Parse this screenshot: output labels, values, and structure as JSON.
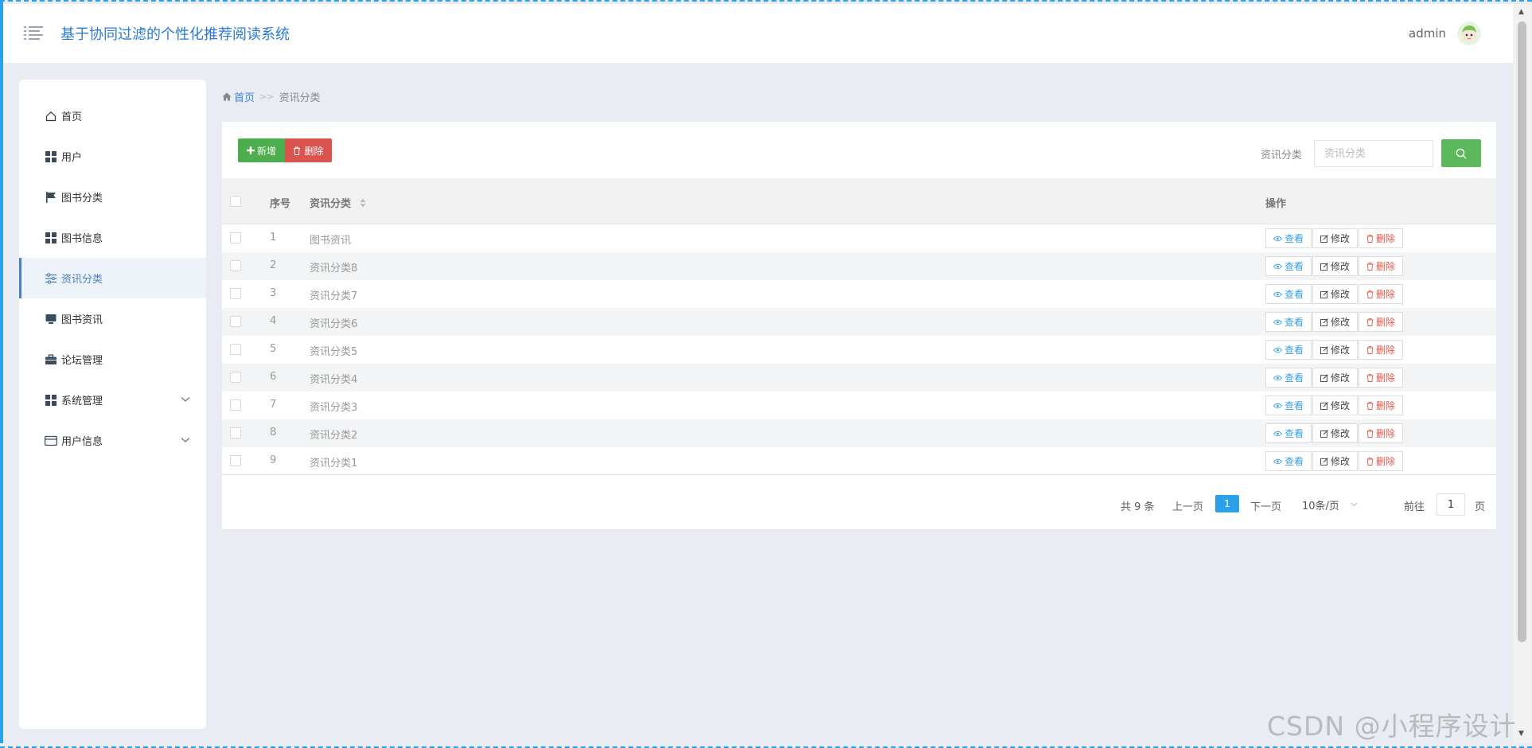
{
  "header": {
    "title": "基于协同过滤的个性化推荐阅读系统",
    "username": "admin"
  },
  "sidebar": {
    "items": [
      {
        "label": "首页",
        "icon": "home-icon"
      },
      {
        "label": "用户",
        "icon": "grid-icon"
      },
      {
        "label": "图书分类",
        "icon": "flag-icon"
      },
      {
        "label": "图书信息",
        "icon": "grid-icon"
      },
      {
        "label": "资讯分类",
        "icon": "sliders-icon",
        "active": true
      },
      {
        "label": "图书资讯",
        "icon": "monitor-icon"
      },
      {
        "label": "论坛管理",
        "icon": "briefcase-icon"
      },
      {
        "label": "系统管理",
        "icon": "grid-icon",
        "expandable": true
      },
      {
        "label": "用户信息",
        "icon": "card-icon",
        "expandable": true
      }
    ]
  },
  "breadcrumb": {
    "home": "首页",
    "separator": ">>",
    "current": "资讯分类"
  },
  "toolbar": {
    "add_label": "新增",
    "delete_label": "删除",
    "search_label": "资讯分类",
    "search_placeholder": "资讯分类"
  },
  "table": {
    "headers": {
      "index": "序号",
      "category": "资讯分类",
      "actions": "操作"
    },
    "rows": [
      {
        "index": "1",
        "category": "图书资讯"
      },
      {
        "index": "2",
        "category": "资讯分类8"
      },
      {
        "index": "3",
        "category": "资讯分类7"
      },
      {
        "index": "4",
        "category": "资讯分类6"
      },
      {
        "index": "5",
        "category": "资讯分类5"
      },
      {
        "index": "6",
        "category": "资讯分类4"
      },
      {
        "index": "7",
        "category": "资讯分类3"
      },
      {
        "index": "8",
        "category": "资讯分类2"
      },
      {
        "index": "9",
        "category": "资讯分类1"
      }
    ],
    "row_actions": {
      "view": "查看",
      "edit": "修改",
      "delete": "删除"
    }
  },
  "pagination": {
    "total": "共 9 条",
    "prev": "上一页",
    "current_page": "1",
    "next": "下一页",
    "page_size": "10条/页",
    "goto_label": "前往",
    "goto_value": "1",
    "goto_suffix": "页"
  },
  "watermark": "CSDN @小程序设计",
  "colors": {
    "accent": "#2aa1e8",
    "title_blue": "#2a7bd5",
    "add_green": "#4cae4c",
    "delete_red": "#d9534f",
    "search_green": "#5cb85c",
    "view_blue": "#3aa0e4",
    "remove_red": "#e2594b"
  }
}
